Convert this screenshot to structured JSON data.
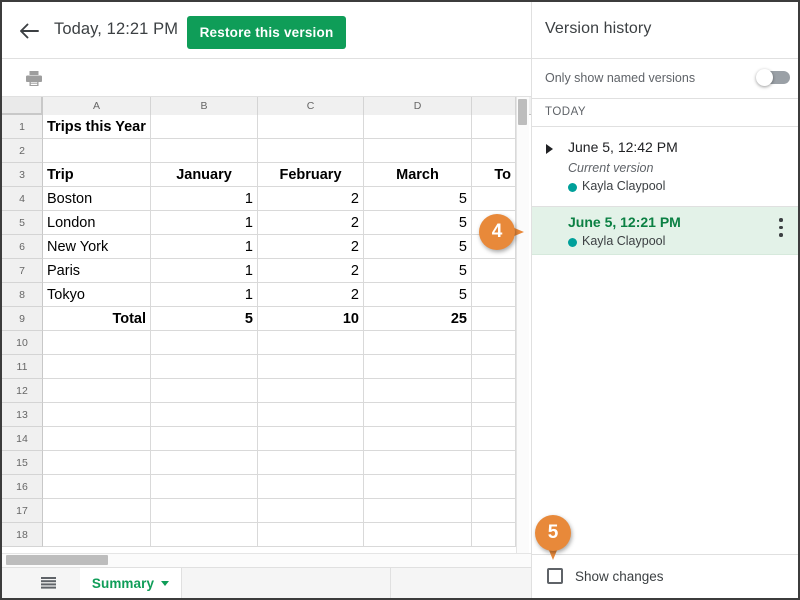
{
  "topbar": {
    "back_icon": "back-arrow-icon",
    "doc_title": "Today, 12:21 PM",
    "restore_label": "Restore this version"
  },
  "sheet_toolbar": {
    "print_icon": "print-icon"
  },
  "spreadsheet": {
    "column_headers": [
      "A",
      "B",
      "C",
      "D"
    ],
    "row_numbers": [
      "1",
      "2",
      "3",
      "4",
      "5",
      "6",
      "7",
      "8",
      "9",
      "10",
      "11",
      "12",
      "13",
      "14",
      "15",
      "16",
      "17",
      "18"
    ],
    "cells": [
      {
        "row": 1,
        "col": "A",
        "value": "Trips this Year",
        "bold": true,
        "align": "left"
      },
      {
        "row": 3,
        "col": "A",
        "value": "Trip",
        "bold": true,
        "align": "left"
      },
      {
        "row": 3,
        "col": "B",
        "value": "January",
        "bold": true,
        "align": "center"
      },
      {
        "row": 3,
        "col": "C",
        "value": "February",
        "bold": true,
        "align": "center"
      },
      {
        "row": 3,
        "col": "D",
        "value": "March",
        "bold": true,
        "align": "center"
      },
      {
        "row": 3,
        "col": "E",
        "value": "To",
        "bold": true,
        "align": "right"
      },
      {
        "row": 4,
        "col": "A",
        "value": "Boston",
        "bold": false,
        "align": "left"
      },
      {
        "row": 4,
        "col": "B",
        "value": "1",
        "bold": false,
        "align": "right"
      },
      {
        "row": 4,
        "col": "C",
        "value": "2",
        "bold": false,
        "align": "right"
      },
      {
        "row": 4,
        "col": "D",
        "value": "5",
        "bold": false,
        "align": "right"
      },
      {
        "row": 5,
        "col": "A",
        "value": "London",
        "bold": false,
        "align": "left"
      },
      {
        "row": 5,
        "col": "B",
        "value": "1",
        "bold": false,
        "align": "right"
      },
      {
        "row": 5,
        "col": "C",
        "value": "2",
        "bold": false,
        "align": "right"
      },
      {
        "row": 5,
        "col": "D",
        "value": "5",
        "bold": false,
        "align": "right"
      },
      {
        "row": 6,
        "col": "A",
        "value": "New York",
        "bold": false,
        "align": "left"
      },
      {
        "row": 6,
        "col": "B",
        "value": "1",
        "bold": false,
        "align": "right"
      },
      {
        "row": 6,
        "col": "C",
        "value": "2",
        "bold": false,
        "align": "right"
      },
      {
        "row": 6,
        "col": "D",
        "value": "5",
        "bold": false,
        "align": "right"
      },
      {
        "row": 7,
        "col": "A",
        "value": "Paris",
        "bold": false,
        "align": "left"
      },
      {
        "row": 7,
        "col": "B",
        "value": "1",
        "bold": false,
        "align": "right"
      },
      {
        "row": 7,
        "col": "C",
        "value": "2",
        "bold": false,
        "align": "right"
      },
      {
        "row": 7,
        "col": "D",
        "value": "5",
        "bold": false,
        "align": "right"
      },
      {
        "row": 8,
        "col": "A",
        "value": "Tokyo",
        "bold": false,
        "align": "left"
      },
      {
        "row": 8,
        "col": "B",
        "value": "1",
        "bold": false,
        "align": "right"
      },
      {
        "row": 8,
        "col": "C",
        "value": "2",
        "bold": false,
        "align": "right"
      },
      {
        "row": 8,
        "col": "D",
        "value": "5",
        "bold": false,
        "align": "right"
      },
      {
        "row": 9,
        "col": "A",
        "value": "Total",
        "bold": true,
        "align": "right"
      },
      {
        "row": 9,
        "col": "B",
        "value": "5",
        "bold": true,
        "align": "right"
      },
      {
        "row": 9,
        "col": "C",
        "value": "10",
        "bold": true,
        "align": "right"
      },
      {
        "row": 9,
        "col": "D",
        "value": "25",
        "bold": true,
        "align": "right"
      }
    ]
  },
  "tabbar": {
    "all_sheets_icon": "all-sheets-icon",
    "sheet_name": "Summary",
    "caret_icon": "chevron-down-icon"
  },
  "panel": {
    "title": "Version history",
    "only_named_label": "Only show named versions",
    "only_named_toggle_on": false,
    "group_label": "TODAY",
    "versions": [
      {
        "time": "June 5, 12:42 PM",
        "subtitle": "Current version",
        "author": "Kayla Claypool",
        "author_color": "#00a09a",
        "selected": false,
        "expandable": true
      },
      {
        "time": "June 5, 12:21 PM",
        "subtitle": "",
        "author": "Kayla Claypool",
        "author_color": "#00a09a",
        "selected": true,
        "expandable": false
      }
    ],
    "show_changes_label": "Show changes",
    "show_changes_checked": false
  },
  "callouts": [
    {
      "number": "4",
      "direction": "right"
    },
    {
      "number": "5",
      "direction": "down"
    }
  ],
  "colors": {
    "accent_green": "#0f9d58",
    "selected_green_bg": "#e3f2e8",
    "selected_green_text": "#0b8043",
    "callout_orange": "#e8893a",
    "author_teal": "#00a09a"
  }
}
